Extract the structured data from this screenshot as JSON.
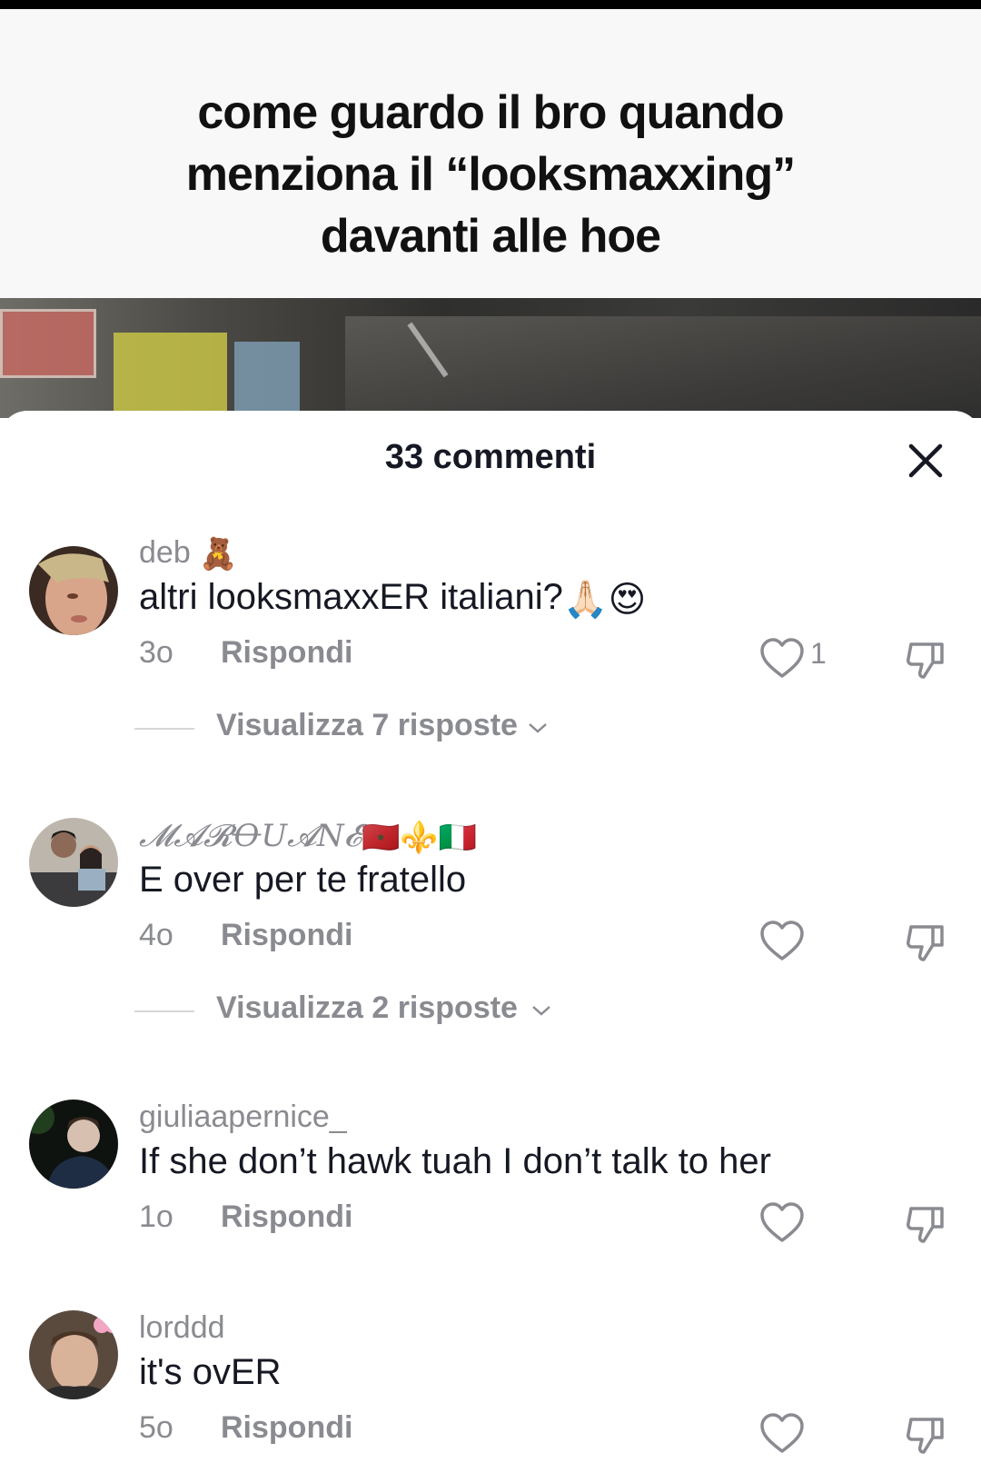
{
  "video": {
    "caption_lines": [
      "come guardo il bro quando",
      "menziona il “looksmaxxing”",
      "davanti alle hoe"
    ]
  },
  "comments_panel": {
    "title": "33 commenti",
    "close_icon": "close-icon",
    "comments": [
      {
        "username": "deb",
        "username_emoji": "🧸",
        "text": "altri looksmaxxER italiani?",
        "text_emoji": "🙏🏻😍",
        "time": "3o",
        "reply_label": "Rispondi",
        "likes": "1",
        "view_replies": "Visualizza 7 risposte"
      },
      {
        "username": "𝓜𝓐𝓡ꝊU𝓐N𝓔",
        "username_emoji": "🇲🇦⚜️🇮🇹",
        "text": "E over per te fratello",
        "time": "4o",
        "reply_label": "Rispondi",
        "likes": "",
        "view_replies": "Visualizza 2 risposte"
      },
      {
        "username": "giuliaapernice_",
        "text": "If she don’t hawk tuah I don’t talk to her",
        "time": "1o",
        "reply_label": "Rispondi",
        "likes": ""
      },
      {
        "username": "lorddd",
        "text": "it's ovER",
        "time": "5o",
        "reply_label": "Rispondi",
        "likes": ""
      }
    ]
  },
  "colors": {
    "muted_text": "#8a8b91",
    "primary_text": "#161823"
  }
}
